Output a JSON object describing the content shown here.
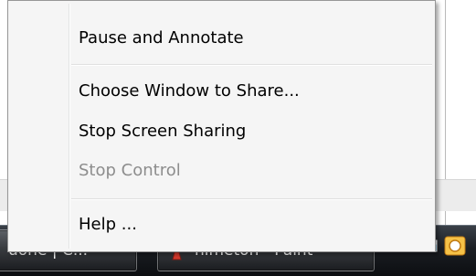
{
  "context_menu": {
    "items": [
      {
        "label": "Pause and Annotate",
        "enabled": true
      },
      {
        "label": "Choose Window to Share...",
        "enabled": true
      },
      {
        "label": "Stop Screen Sharing",
        "enabled": true
      },
      {
        "label": "Stop Control",
        "enabled": false
      },
      {
        "label": "Help ...",
        "enabled": true
      }
    ]
  },
  "taskbar": {
    "buttons": [
      {
        "label": "uone | C...",
        "icon": "app-icon"
      },
      {
        "label": "nimeton - Paint",
        "icon": "paint-icon"
      }
    ],
    "tray": {
      "overflow_icon": "chevron-left-icon",
      "icons": [
        "network-icon",
        "chat-icon"
      ]
    }
  },
  "colors": {
    "menu_background": "#f5f5f5",
    "menu_border": "#979797",
    "disabled_text": "#8d8d8d",
    "taskbar": "#1b1e23"
  }
}
